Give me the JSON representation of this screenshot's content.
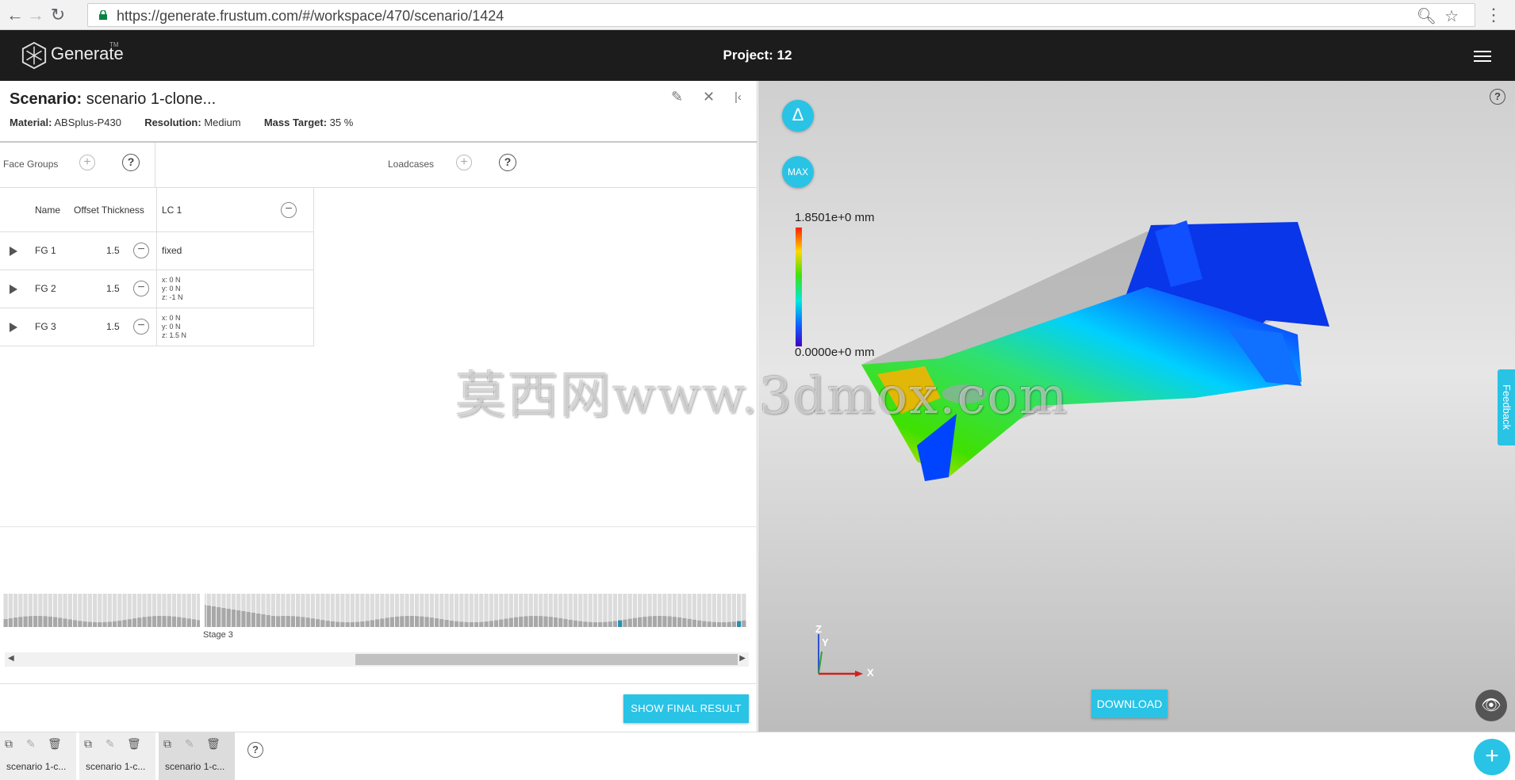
{
  "browser": {
    "url": "https://generate.frustum.com/#/workspace/470/scenario/1424"
  },
  "app": {
    "logo_text": "Generate",
    "logo_tm": "TM",
    "project_title": "Project: 12"
  },
  "scenario": {
    "title_label": "Scenario:",
    "title_value": "scenario 1-clone...",
    "material_label": "Material:",
    "material_value": "ABSplus-P430",
    "resolution_label": "Resolution:",
    "resolution_value": "Medium",
    "mass_label": "Mass Target:",
    "mass_value": "35 %"
  },
  "panel": {
    "face_groups_label": "Face Groups",
    "loadcases_label": "Loadcases",
    "help_symbol": "?",
    "plus_symbol": "+"
  },
  "table": {
    "headers": {
      "name": "Name",
      "thickness": "Offset Thickness",
      "lc": "LC 1"
    },
    "rows": [
      {
        "name": "FG 1",
        "thickness": "1.5",
        "lc": "fixed",
        "lc_lines": []
      },
      {
        "name": "FG 2",
        "thickness": "1.5",
        "lc": "",
        "lc_lines": [
          "x: 0 N",
          "y: 0 N",
          "z: -1 N"
        ]
      },
      {
        "name": "FG 3",
        "thickness": "1.5",
        "lc": "",
        "lc_lines": [
          "x: 0 N",
          "y: 0 N",
          "z: 1.5 N"
        ]
      }
    ]
  },
  "stages": {
    "label": "Stage 3",
    "show_final_result": "SHOW FINAL RESULT"
  },
  "viewer": {
    "delta_symbol": "Δ",
    "max_label": "MAX",
    "legend_max": "1.8501e+0 mm",
    "legend_min": "0.0000e+0 mm",
    "help_symbol": "?",
    "feedback": "Feedback",
    "download": "DOWNLOAD",
    "axis_z": "Z",
    "axis_y": "Y",
    "axis_x": "X"
  },
  "tabs": [
    {
      "label": "scenario 1-c..."
    },
    {
      "label": "scenario 1-c..."
    },
    {
      "label": "scenario 1-c..."
    }
  ],
  "bottom": {
    "help_symbol": "?",
    "add_symbol": "+"
  },
  "watermark": "莫西网www.3dmox.com",
  "colors": {
    "accent": "#29c3e6",
    "appbar": "#1c1c1c"
  }
}
